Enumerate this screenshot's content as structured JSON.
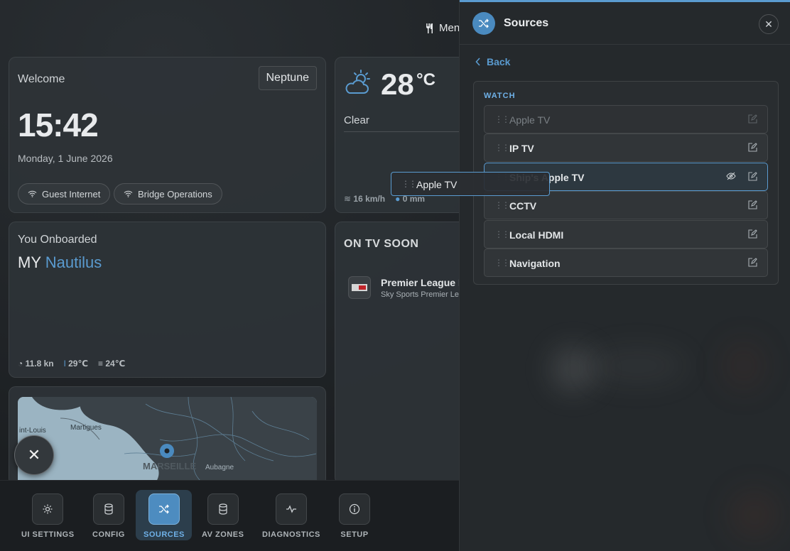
{
  "top_menu": {
    "label": "Men"
  },
  "welcome": {
    "title": "Welcome",
    "vessel": "Neptune",
    "time": "15:42",
    "date": "Monday, 1 June 2026",
    "wifi": [
      "Guest Internet",
      "Bridge Operations"
    ]
  },
  "weather": {
    "temp": "28",
    "unit": "°C",
    "condition": "Clear",
    "wind": "16 km/h",
    "rain": "0 mm"
  },
  "onboard": {
    "title": "You Onboarded",
    "prefix": "MY",
    "ship": "Nautilus",
    "speed": "11.8 kn",
    "air_temp": "29℃",
    "water_temp": "24℃"
  },
  "tv_soon": {
    "title": "ON TV SOON",
    "item_title": "Premier League Li",
    "item_channel": "Sky Sports Premier Lea"
  },
  "map": {
    "labels": [
      "int-Louis",
      "Martigues",
      "MARSEILLE",
      "Aubagne"
    ]
  },
  "nav": {
    "items": [
      {
        "label": "UI SETTINGS",
        "icon": "gear-icon"
      },
      {
        "label": "CONFIG",
        "icon": "database-icon"
      },
      {
        "label": "SOURCES",
        "icon": "shuffle-icon"
      },
      {
        "label": "AV ZONES",
        "icon": "database-icon"
      },
      {
        "label": "DIAGNOSTICS",
        "icon": "pulse-icon"
      },
      {
        "label": "SETUP",
        "icon": "info-icon"
      }
    ],
    "active": "SOURCES"
  },
  "panel": {
    "title": "Sources",
    "back": "Back",
    "section": "WATCH",
    "sources": [
      {
        "name": "Apple TV"
      },
      {
        "name": "IP TV"
      },
      {
        "name": "Ship's Apple TV"
      },
      {
        "name": "CCTV"
      },
      {
        "name": "Local HDMI"
      },
      {
        "name": "Navigation"
      }
    ],
    "dragging": "Apple TV"
  },
  "colors": {
    "accent": "#5a9bd0",
    "background": "#1f2326",
    "panel": "#25292c"
  }
}
